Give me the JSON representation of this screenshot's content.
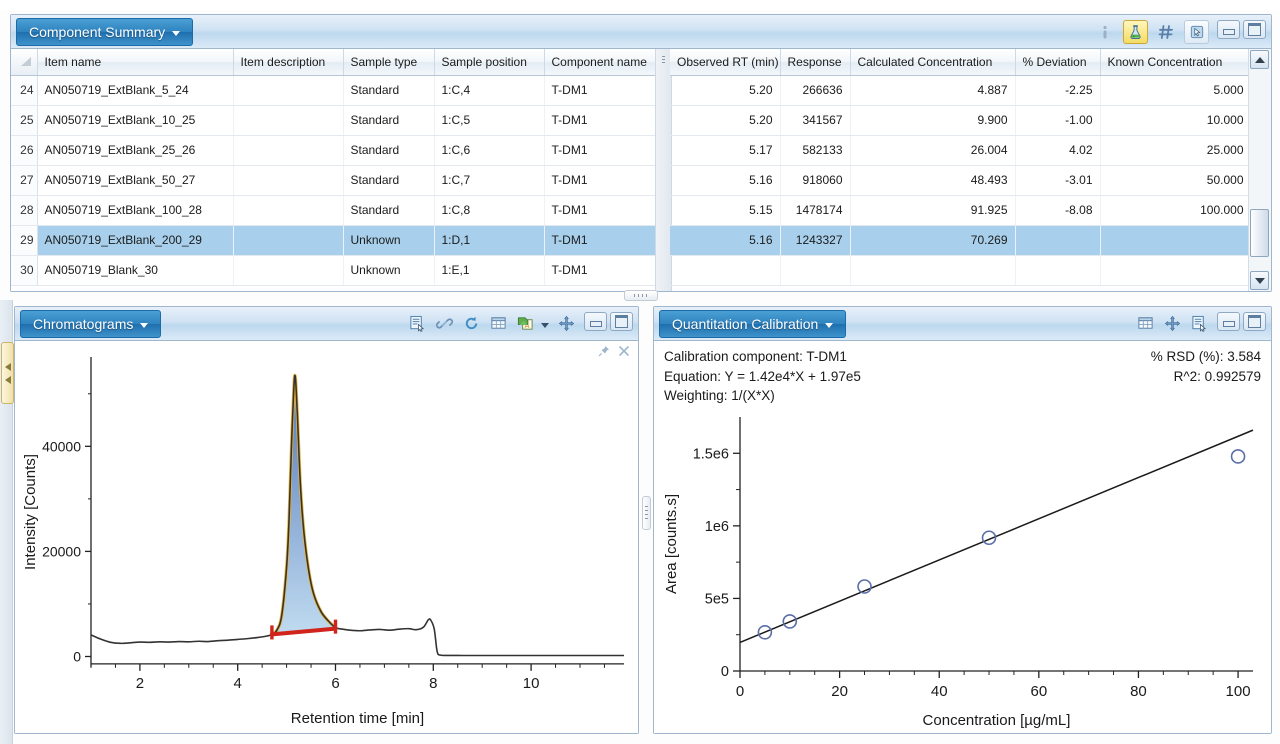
{
  "summary_panel": {
    "title": "Component Summary",
    "tools": {
      "info_icon": "info-icon",
      "flask_icon": "flask-icon",
      "hash_icon": "hash-icon",
      "pointer_icon": "pointer-icon",
      "minimize": "minimize-icon",
      "maximize": "maximize-icon"
    },
    "columns_left": [
      "Item name",
      "Item description",
      "Sample type",
      "Sample position",
      "Component name"
    ],
    "columns_right": [
      "Observed RT (min)",
      "Response",
      "Calculated Concentration",
      "% Deviation",
      "Known Concentration"
    ],
    "rows": [
      {
        "n": "24",
        "item_name": "AN050719_ExtBlank_5_24",
        "item_description": "",
        "sample_type": "Standard",
        "sample_position": "1:C,4",
        "component_name": "T-DM1",
        "observed_rt": "5.20",
        "response": "266636",
        "calc_conc": "4.887",
        "pct_dev": "-2.25",
        "known_conc": "5.000",
        "selected": false
      },
      {
        "n": "25",
        "item_name": "AN050719_ExtBlank_10_25",
        "item_description": "",
        "sample_type": "Standard",
        "sample_position": "1:C,5",
        "component_name": "T-DM1",
        "observed_rt": "5.20",
        "response": "341567",
        "calc_conc": "9.900",
        "pct_dev": "-1.00",
        "known_conc": "10.000",
        "selected": false
      },
      {
        "n": "26",
        "item_name": "AN050719_ExtBlank_25_26",
        "item_description": "",
        "sample_type": "Standard",
        "sample_position": "1:C,6",
        "component_name": "T-DM1",
        "observed_rt": "5.17",
        "response": "582133",
        "calc_conc": "26.004",
        "pct_dev": "4.02",
        "known_conc": "25.000",
        "selected": false
      },
      {
        "n": "27",
        "item_name": "AN050719_ExtBlank_50_27",
        "item_description": "",
        "sample_type": "Standard",
        "sample_position": "1:C,7",
        "component_name": "T-DM1",
        "observed_rt": "5.16",
        "response": "918060",
        "calc_conc": "48.493",
        "pct_dev": "-3.01",
        "known_conc": "50.000",
        "selected": false
      },
      {
        "n": "28",
        "item_name": "AN050719_ExtBlank_100_28",
        "item_description": "",
        "sample_type": "Standard",
        "sample_position": "1:C,8",
        "component_name": "T-DM1",
        "observed_rt": "5.15",
        "response": "1478174",
        "calc_conc": "91.925",
        "pct_dev": "-8.08",
        "known_conc": "100.000",
        "selected": false
      },
      {
        "n": "29",
        "item_name": "AN050719_ExtBlank_200_29",
        "item_description": "",
        "sample_type": "Unknown",
        "sample_position": "1:D,1",
        "component_name": "T-DM1",
        "observed_rt": "5.16",
        "response": "1243327",
        "calc_conc": "70.269",
        "pct_dev": "",
        "known_conc": "",
        "selected": true
      },
      {
        "n": "30",
        "item_name": "AN050719_Blank_30",
        "item_description": "",
        "sample_type": "Unknown",
        "sample_position": "1:E,1",
        "component_name": "T-DM1",
        "observed_rt": "",
        "response": "",
        "calc_conc": "",
        "pct_dev": "",
        "known_conc": "",
        "selected": false
      }
    ]
  },
  "chrom_panel": {
    "title": "Chromatograms",
    "tools": [
      "report-icon",
      "link-icon",
      "refresh-icon",
      "table-icon",
      "export-icon",
      "dropdown-caret-icon",
      "move-icon"
    ],
    "pin_icon": "pin-icon",
    "close_icon": "close-icon"
  },
  "calib_panel": {
    "title": "Quantitation Calibration",
    "tools": [
      "table-icon",
      "move-icon",
      "report-icon"
    ],
    "info_left": [
      "Calibration component: T-DM1",
      "Equation: Y = 1.42e4*X + 1.97e5",
      "Weighting: 1/(X*X)"
    ],
    "info_right": [
      "% RSD (%): 3.584",
      "R^2: 0.992579"
    ]
  },
  "chart_data": [
    {
      "type": "line",
      "name": "chromatogram",
      "title": "",
      "xlabel": "Retention time [min]",
      "ylabel": "Intensity [Counts]",
      "xlim": [
        1.0,
        11.9
      ],
      "ylim": [
        -2000,
        57000
      ],
      "xticks": [
        2,
        4,
        6,
        8,
        10
      ],
      "xticklabels": [
        "2",
        "4",
        "6",
        "8",
        "10"
      ],
      "yticks": [
        0,
        20000,
        40000
      ],
      "yticklabels": [
        "0",
        "20000",
        "40000"
      ],
      "grid": false,
      "trace_color": "#333333",
      "peak_fill_top_color": "#4a6fb5",
      "peak_fill_bottom_color": "#bcd9ef",
      "peak_outline_color": "#e8b33a",
      "baseline_color": "#d0241c",
      "integration": {
        "start_x": 4.7,
        "end_x": 6.0,
        "apex_x": 5.18,
        "apex_y": 53000,
        "baseline_y": 4200
      },
      "x": [
        1.0,
        1.2,
        1.4,
        1.6,
        1.8,
        2.0,
        2.2,
        2.4,
        2.6,
        2.8,
        3.0,
        3.2,
        3.4,
        3.6,
        3.8,
        4.0,
        4.2,
        4.4,
        4.6,
        4.7,
        4.8,
        4.9,
        5.0,
        5.05,
        5.1,
        5.15,
        5.18,
        5.22,
        5.28,
        5.35,
        5.45,
        5.55,
        5.7,
        5.85,
        6.0,
        6.15,
        6.3,
        6.5,
        6.7,
        6.9,
        7.1,
        7.3,
        7.5,
        7.65,
        7.8,
        7.9,
        7.95,
        8.02,
        8.08,
        8.15,
        8.3,
        8.6,
        9.0,
        9.5,
        10.0,
        10.6,
        11.2,
        11.9
      ],
      "y": [
        4100,
        3300,
        2700,
        2500,
        2600,
        2750,
        2700,
        2800,
        2750,
        2850,
        2800,
        2900,
        2850,
        3000,
        3100,
        3250,
        3400,
        3600,
        3900,
        4200,
        5000,
        7800,
        17000,
        26000,
        40000,
        51500,
        53000,
        46000,
        33000,
        24000,
        16500,
        12000,
        8600,
        6800,
        5500,
        5200,
        5000,
        4900,
        5050,
        5150,
        5000,
        5200,
        5300,
        5100,
        5600,
        7000,
        6900,
        5200,
        900,
        260,
        200,
        190,
        190,
        190,
        190,
        190,
        190,
        190
      ]
    },
    {
      "type": "scatter",
      "name": "calibration-curve",
      "title": "",
      "xlabel": "Concentration [µg/mL]",
      "ylabel": "Area [counts.s]",
      "xlim": [
        0,
        103
      ],
      "ylim": [
        0,
        1750000
      ],
      "xticks": [
        0,
        20,
        40,
        60,
        80,
        100
      ],
      "xticklabels": [
        "0",
        "20",
        "40",
        "60",
        "80",
        "100"
      ],
      "yticks": [
        0,
        500000,
        1000000,
        1500000
      ],
      "yticklabels": [
        "0",
        "5e5",
        "1e6",
        "1.5e6"
      ],
      "grid": false,
      "marker": "open-circle",
      "marker_color": "#5a6ea8",
      "line_color": "#1a1a1a",
      "points_x": [
        5,
        10,
        25,
        50,
        100
      ],
      "points_y": [
        266636,
        341567,
        582133,
        918060,
        1478174
      ],
      "fit": {
        "slope": 14200,
        "intercept": 197000,
        "equation": "Y = 1.42e4*X + 1.97e5",
        "r2": "0.992579",
        "weighting": "1/(X*X)",
        "rsd": "3.584"
      }
    }
  ]
}
